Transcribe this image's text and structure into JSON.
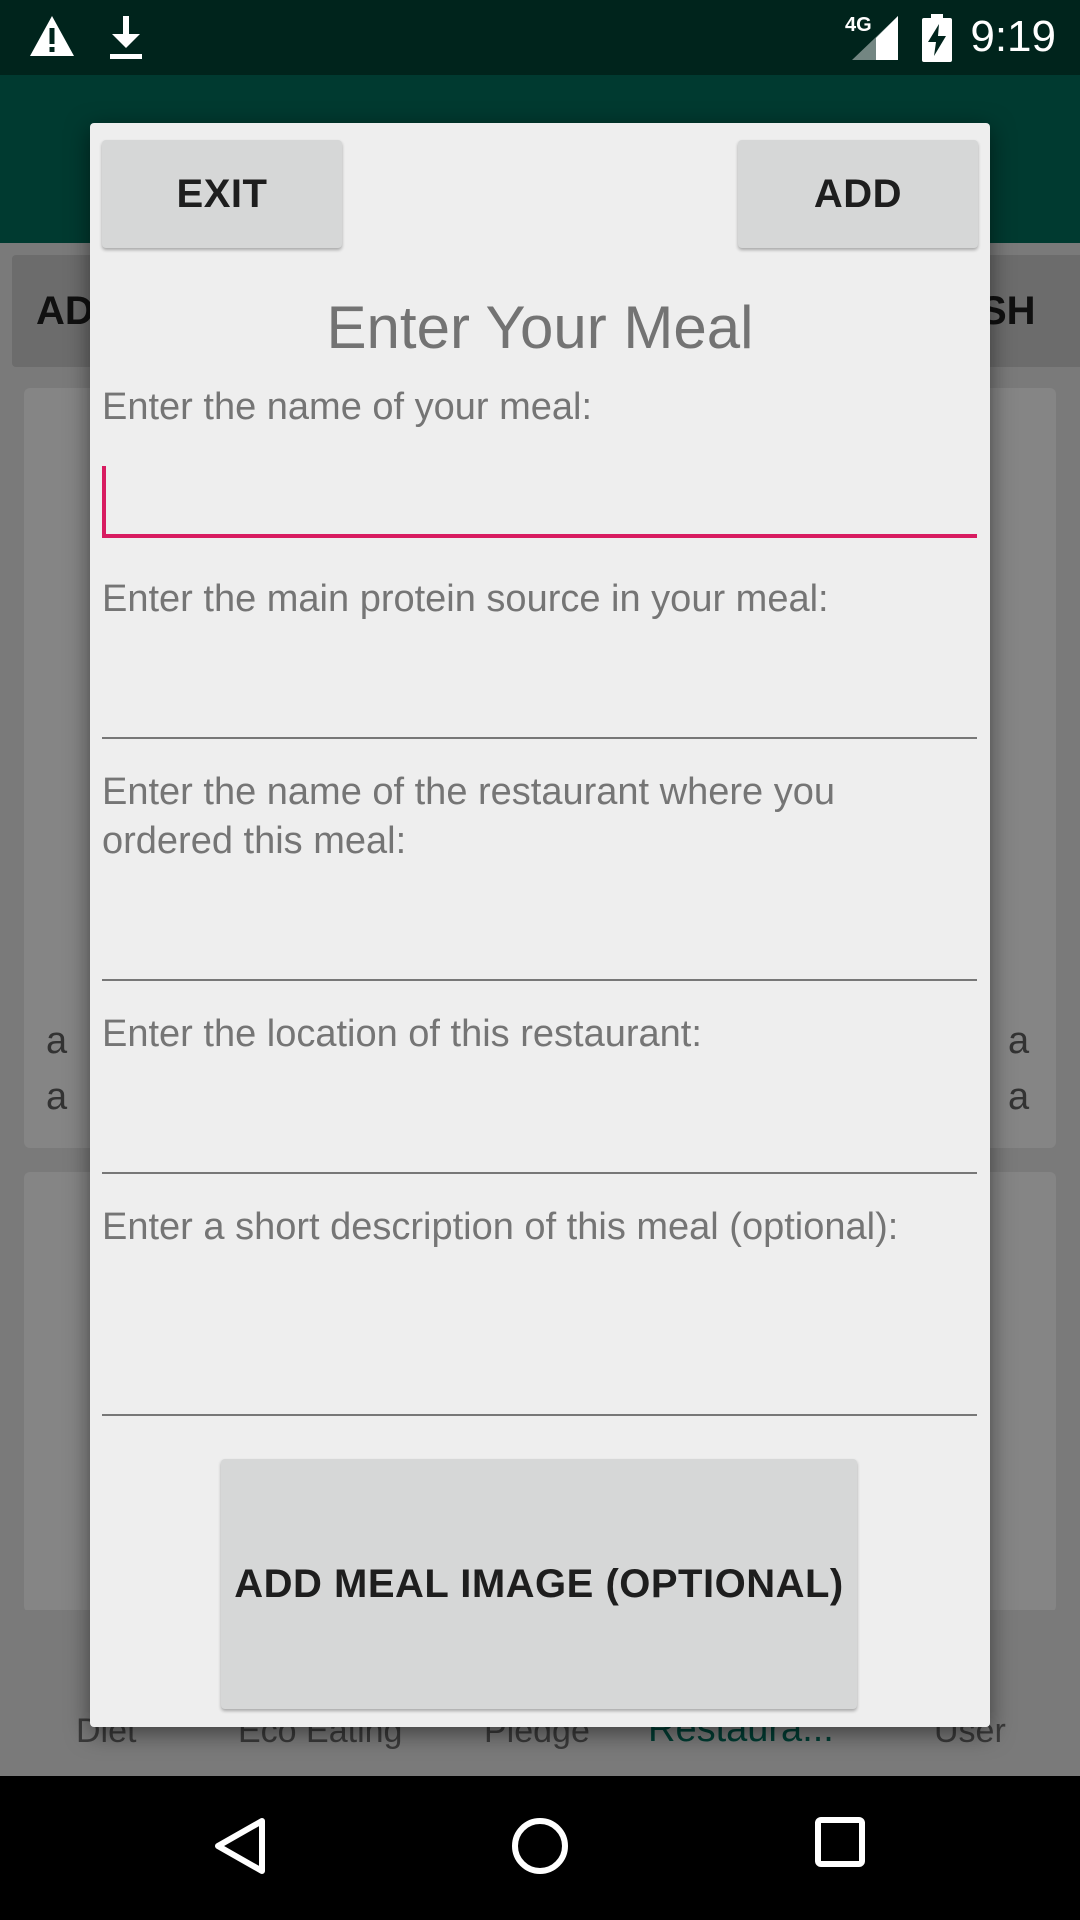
{
  "status_bar": {
    "time": "9:19",
    "network": "4G",
    "icons": [
      "warning-icon",
      "download-icon",
      "signal-4g-icon",
      "battery-charging-icon"
    ]
  },
  "background": {
    "left_button_label": "AD",
    "right_button_label": "SH",
    "card_letters": [
      "a",
      "a",
      "a",
      "a"
    ],
    "bottom_nav": [
      {
        "label": "Diet",
        "icon": "diet-icon"
      },
      {
        "label": "Eco Eating",
        "icon": "eco-icon"
      },
      {
        "label": "Pledge",
        "icon": "pledge-icon"
      },
      {
        "label": "Restaura...",
        "icon": "restaurant-icon",
        "active": true
      },
      {
        "label": "User",
        "icon": "user-icon"
      }
    ]
  },
  "dialog": {
    "exit_label": "EXIT",
    "add_label": "ADD",
    "title": "Enter Your Meal",
    "fields": [
      {
        "label": "Enter the name of your meal:",
        "value": ""
      },
      {
        "label": "Enter the main protein source in your meal:",
        "value": ""
      },
      {
        "label": "Enter the name of the restaurant where you ordered this meal:",
        "value": ""
      },
      {
        "label": "Enter the location of this restaurant:",
        "value": ""
      },
      {
        "label": "Enter a short description of this meal (optional):",
        "value": ""
      }
    ],
    "image_button_label": "ADD MEAL IMAGE (OPTIONAL)"
  },
  "colors": {
    "accent": "#d81b60",
    "primary_dark": "#00241c",
    "primary": "#003a30"
  }
}
